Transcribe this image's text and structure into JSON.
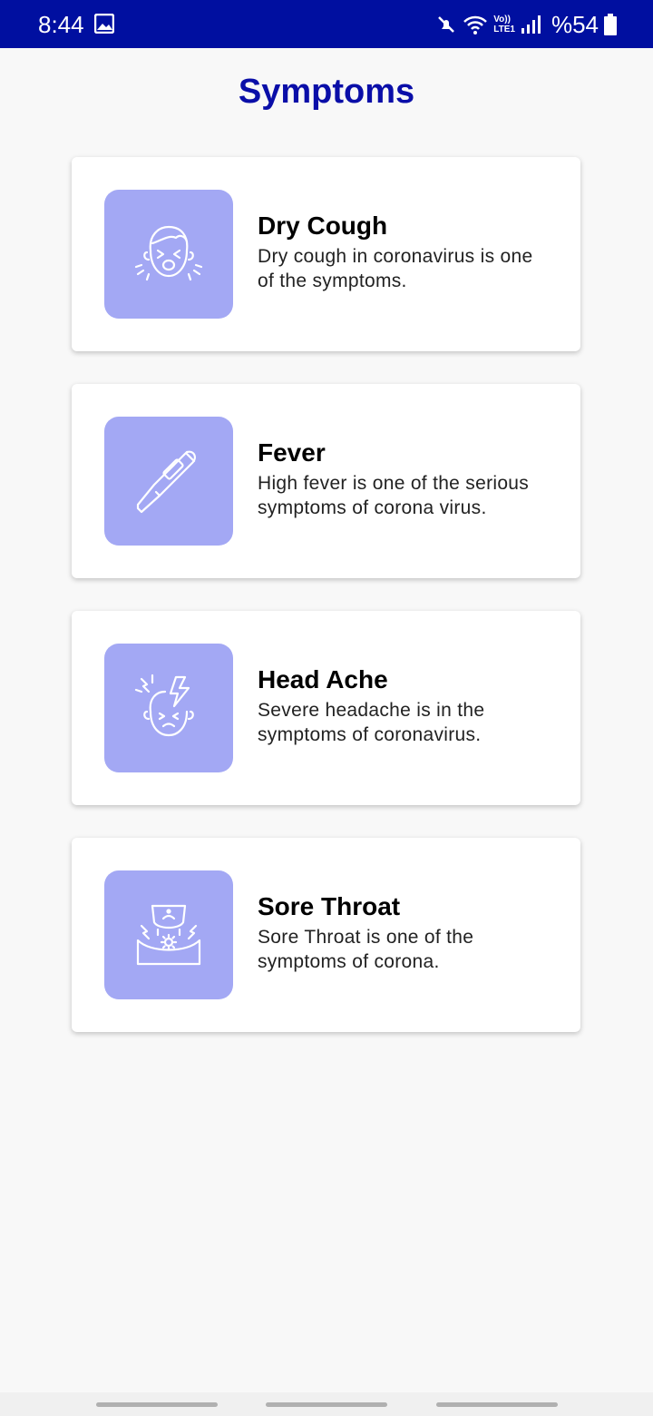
{
  "status_bar": {
    "time": "8:44",
    "network_label_top": "Vo))",
    "network_label_bottom": "LTE1",
    "battery_text": "%54",
    "icons": [
      "gallery-icon",
      "mute-icon",
      "wifi-icon",
      "signal-icon",
      "battery-icon"
    ]
  },
  "page": {
    "title": "Symptoms"
  },
  "symptoms": [
    {
      "title": "Dry Cough",
      "description": "Dry cough in coronavirus is one of the symptoms.",
      "icon": "coughing-face-icon"
    },
    {
      "title": "Fever",
      "description": "High fever is one of the serious symptoms of corona virus.",
      "icon": "thermometer-icon"
    },
    {
      "title": "Head Ache",
      "description": "Severe headache is in the symptoms of coronavirus.",
      "icon": "headache-icon"
    },
    {
      "title": "Sore Throat",
      "description": "Sore Throat is one of the symptoms of corona.",
      "icon": "sore-throat-icon"
    }
  ],
  "colors": {
    "status_bar": "#000fa0",
    "title": "#0a0ea8",
    "icon_box": "#a3a8f4",
    "background": "#f8f8f8"
  }
}
